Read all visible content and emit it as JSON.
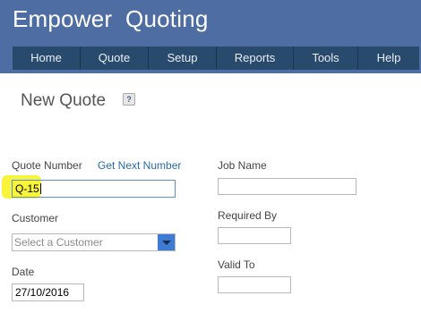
{
  "app": {
    "title": "Empower  Quoting"
  },
  "nav": {
    "items": [
      {
        "label": "Home"
      },
      {
        "label": "Quote"
      },
      {
        "label": "Setup"
      },
      {
        "label": "Reports"
      },
      {
        "label": "Tools"
      },
      {
        "label": "Help"
      }
    ]
  },
  "page": {
    "title": "New Quote",
    "help_icon": "help-icon"
  },
  "form": {
    "quote_number": {
      "label": "Quote Number",
      "link": "Get Next Number",
      "value": "Q-15"
    },
    "customer": {
      "label": "Customer",
      "placeholder": "Select a Customer"
    },
    "date": {
      "label": "Date",
      "value": "27/10/2016"
    },
    "job_name": {
      "label": "Job Name",
      "value": ""
    },
    "required_by": {
      "label": "Required By",
      "value": ""
    },
    "valid_to": {
      "label": "Valid To",
      "value": ""
    }
  },
  "colors": {
    "header_bg": "#4e6ea3",
    "nav_bg": "#284a6c",
    "highlight": "#f7f43b",
    "link": "#2a6aa8",
    "dropdown_button": "#3e7bd5"
  }
}
